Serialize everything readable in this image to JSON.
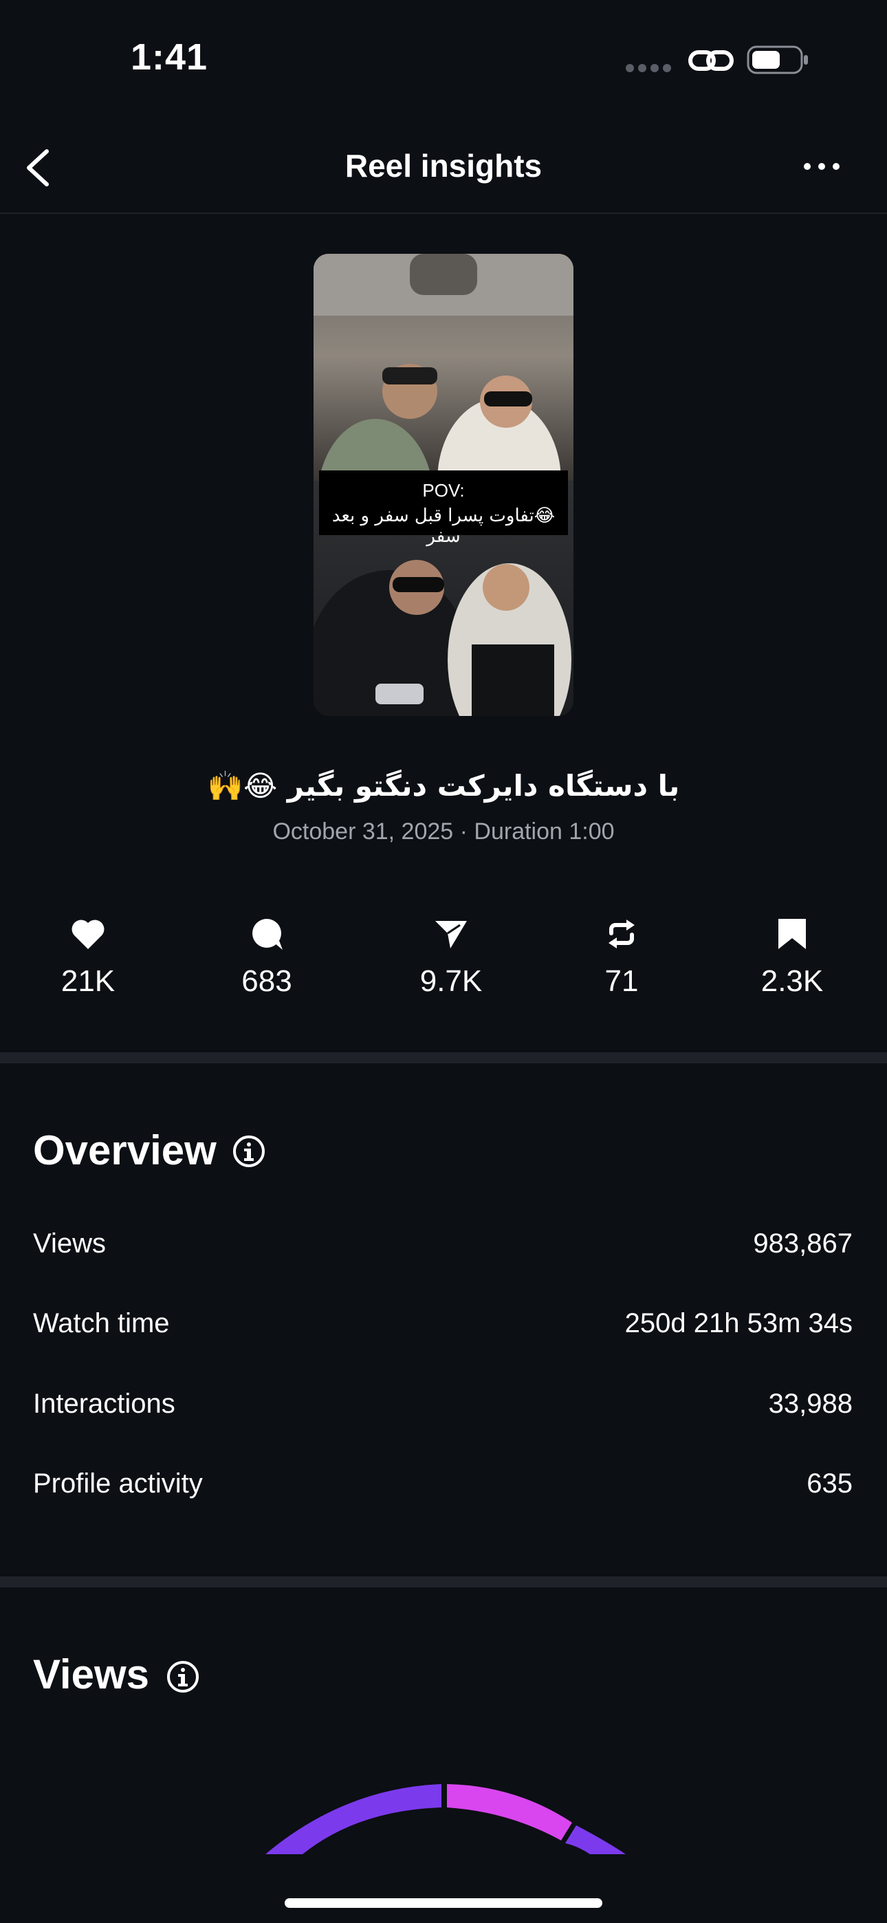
{
  "status_bar": {
    "time": "1:41",
    "battery_icon": "battery-icon",
    "link_icon": "link-icon"
  },
  "header": {
    "title": "Reel insights",
    "back_icon": "chevron-left-icon",
    "more_icon": "more-horizontal-icon"
  },
  "reel": {
    "thumbnail_caption_line1": "POV:",
    "thumbnail_caption_line2": "😂تفاوت پسرا قبل سفر و بعد سفر",
    "title": "با دستگاه دایرکت دنگتو بگیر 😂🙌",
    "date_duration": "October 31, 2025 · Duration 1:00"
  },
  "metrics": [
    {
      "icon": "heart-icon",
      "value": "21K"
    },
    {
      "icon": "comment-icon",
      "value": "683"
    },
    {
      "icon": "send-icon",
      "value": "9.7K"
    },
    {
      "icon": "repost-icon",
      "value": "71"
    },
    {
      "icon": "bookmark-icon",
      "value": "2.3K"
    }
  ],
  "overview": {
    "title": "Overview",
    "rows": [
      {
        "label": "Views",
        "value": "983,867"
      },
      {
        "label": "Watch time",
        "value": "250d 21h 53m 34s"
      },
      {
        "label": "Interactions",
        "value": "33,988"
      },
      {
        "label": "Profile activity",
        "value": "635"
      }
    ]
  },
  "views_section": {
    "title": "Views"
  },
  "colors": {
    "background": "#0c0f14",
    "gauge_purple": "#7c3aed",
    "gauge_magenta": "#d946ef",
    "muted_text": "#a1a6ad"
  }
}
